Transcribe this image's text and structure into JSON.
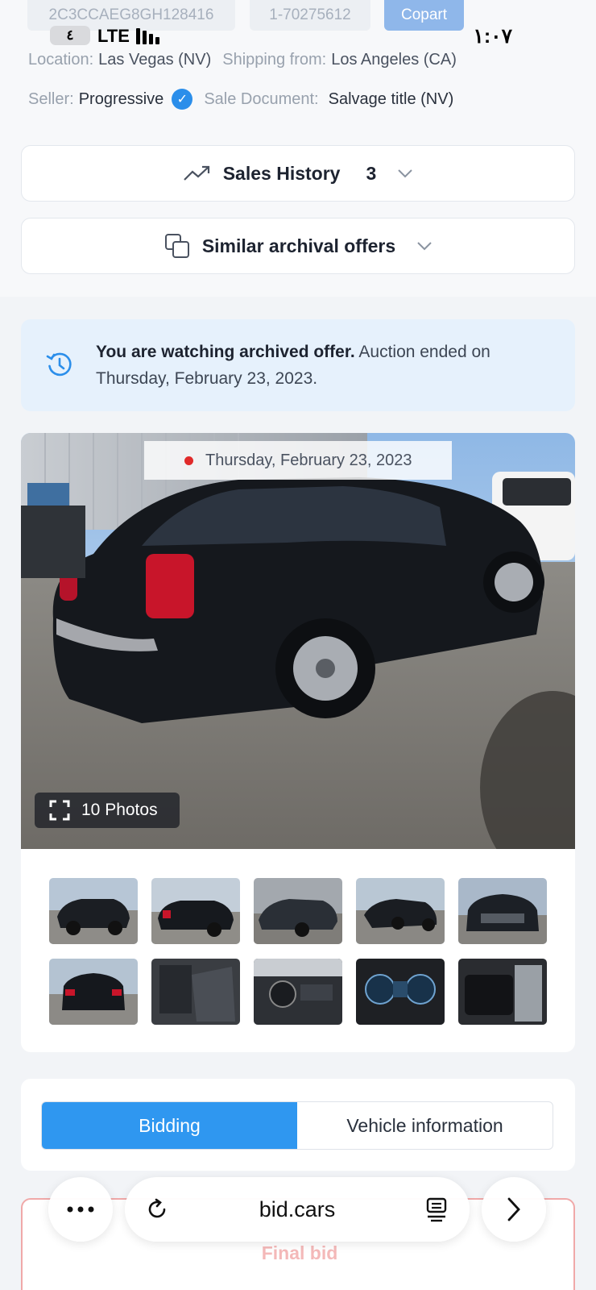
{
  "header_chips": {
    "vin": "2C3CCAEG8GH128416",
    "lot": "1-70275612",
    "source": "Copart"
  },
  "status_bar": {
    "clock_badge": "٤",
    "network": "LTE",
    "time": "١:٠٧"
  },
  "vehicle_meta": {
    "location_label": "Location:",
    "location_value": "Las Vegas (NV)",
    "shipping_label": "Shipping from:",
    "shipping_value": "Los Angeles (CA)",
    "seller_label": "Seller:",
    "seller_value": "Progressive",
    "document_label": "Sale Document:",
    "document_value": "Salvage title (NV)"
  },
  "sales_history": {
    "label": "Sales History",
    "count": "3"
  },
  "similar_offers": {
    "label": "Similar archival offers"
  },
  "notice": {
    "bold": "You are watching archived offer.",
    "text": " Auction ended on Thursday, February 23, 2023."
  },
  "gallery": {
    "date": "Thursday, February 23, 2023",
    "photos_label": "10 Photos"
  },
  "tabs": [
    {
      "label": "Bidding",
      "active": true
    },
    {
      "label": "Vehicle information",
      "active": false
    }
  ],
  "final_bid": {
    "label": "Final bid"
  },
  "browser": {
    "url": "bid.cars"
  },
  "colors": {
    "accent": "#2f97f0",
    "verified": "#2b8eea",
    "notice_bg": "#e6f1fc",
    "bid_border": "#f0a9a9",
    "live_dot": "#e02a2a"
  }
}
